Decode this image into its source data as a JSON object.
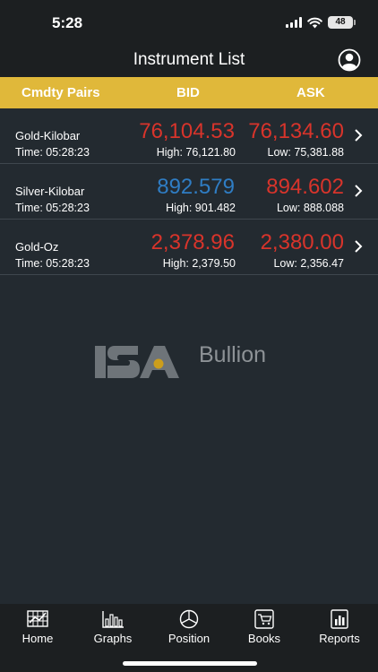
{
  "status_bar": {
    "time": "5:28",
    "battery": "48"
  },
  "nav": {
    "title": "Instrument List"
  },
  "table_header": {
    "pairs": "Cmdty Pairs",
    "bid": "BID",
    "ask": "ASK"
  },
  "instruments": [
    {
      "name": "Gold-Kilobar",
      "time": "Time:  05:28:23",
      "bid": "76,104.53",
      "bid_color": "#d8342b",
      "ask": "76,134.60",
      "ask_color": "#d8342b",
      "high": "High:  76,121.80",
      "low": "Low:  75,381.88"
    },
    {
      "name": "Silver-Kilobar",
      "time": "Time:  05:28:23",
      "bid": "892.579",
      "bid_color": "#2f7dc4",
      "ask": "894.602",
      "ask_color": "#d8342b",
      "high": "High:  901.482",
      "low": "Low:  888.088"
    },
    {
      "name": "Gold-Oz",
      "time": "Time:  05:28:23",
      "bid": "2,378.96",
      "bid_color": "#d8342b",
      "ask": "2,380.00",
      "ask_color": "#d8342b",
      "high": "High:  2,379.50",
      "low": "Low:  2,356.47"
    }
  ],
  "logo": {
    "text": "Bullion"
  },
  "tabs": [
    {
      "label": "Home",
      "icon": "home-grid-icon"
    },
    {
      "label": "Graphs",
      "icon": "bar-chart-icon"
    },
    {
      "label": "Position",
      "icon": "pie-chart-icon"
    },
    {
      "label": "Books",
      "icon": "cart-icon"
    },
    {
      "label": "Reports",
      "icon": "report-icon"
    }
  ],
  "colors": {
    "header_bg": "#e0b83a",
    "page_bg": "#232a30",
    "bar_bg": "#1c1f21",
    "red": "#d8342b",
    "blue": "#2f7dc4"
  }
}
